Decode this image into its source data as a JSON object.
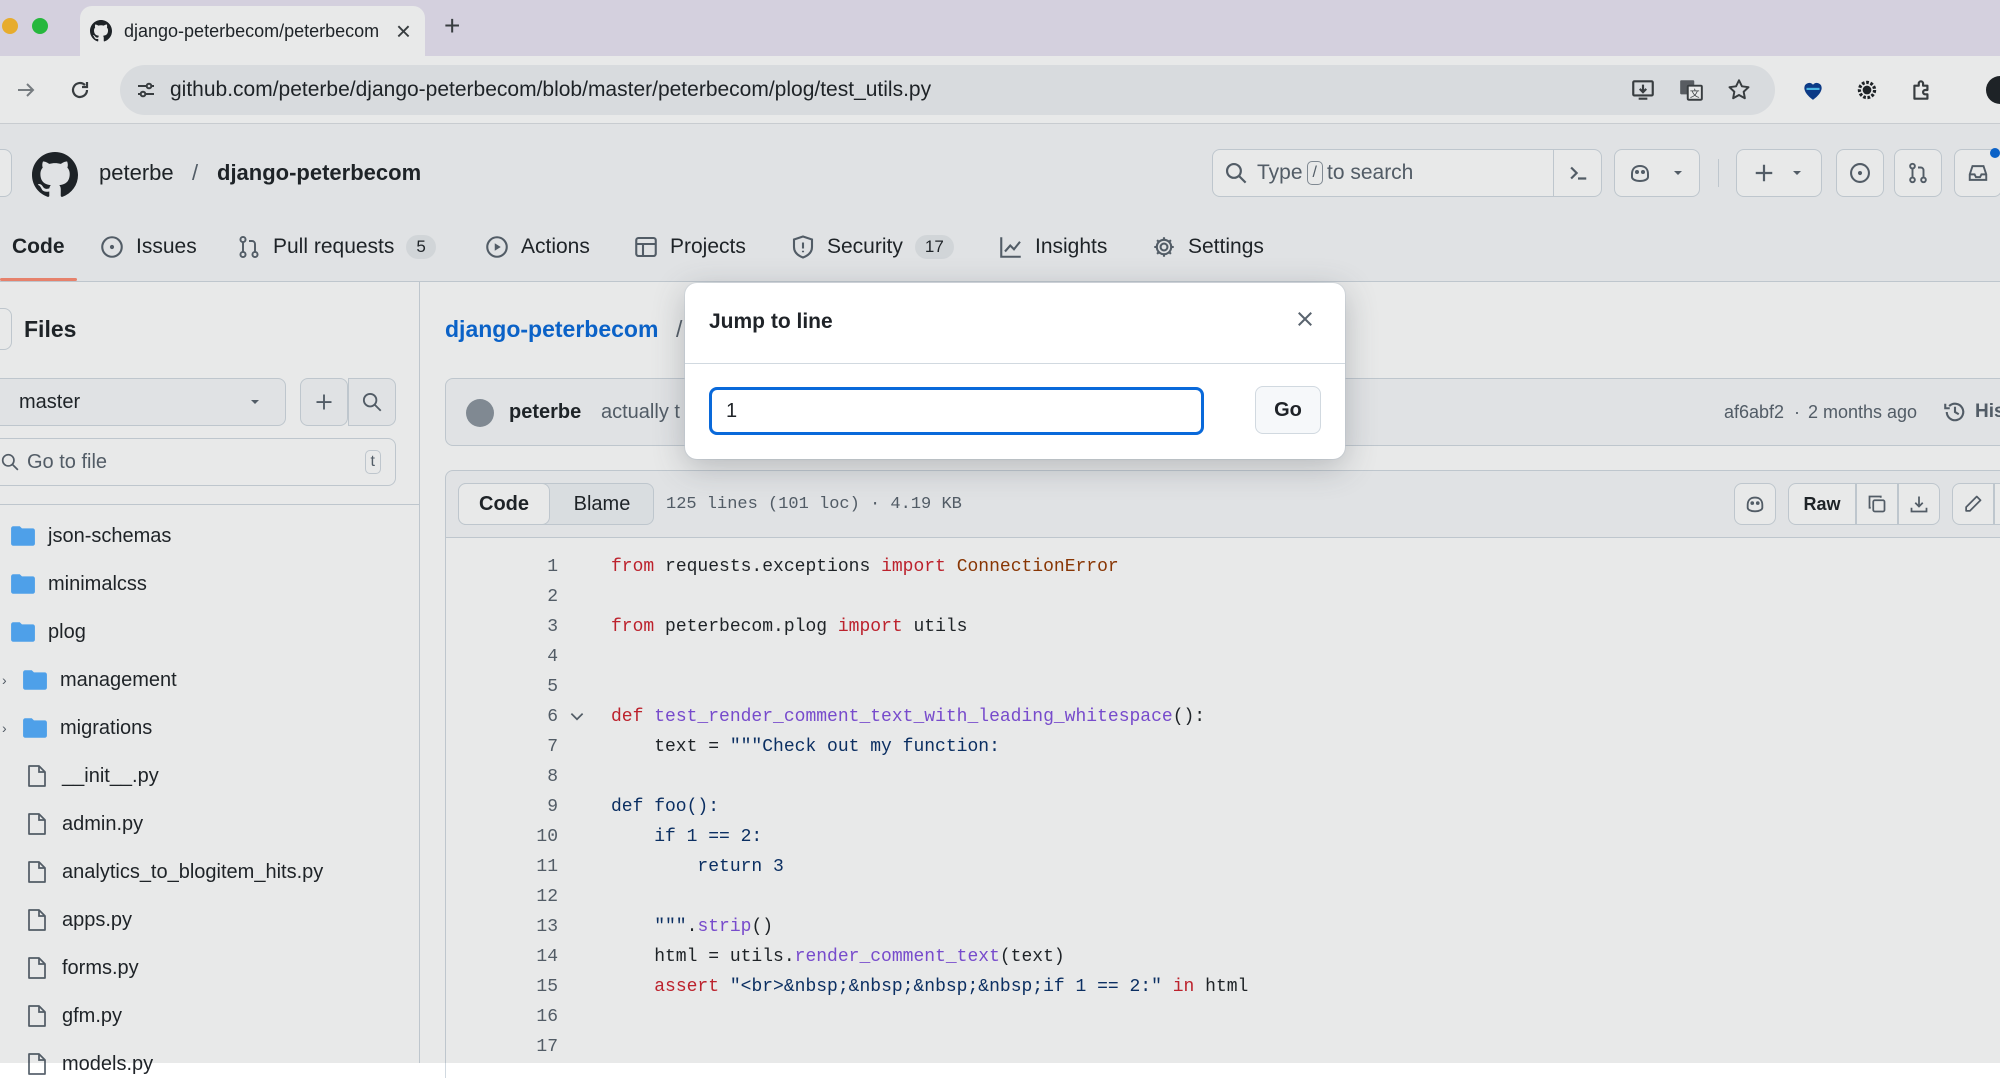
{
  "browser": {
    "tab_title": "django-peterbecom/peterbecom",
    "url": "github.com/peterbe/django-peterbecom/blob/master/peterbecom/plog/test_utils.py",
    "new_tab": "+",
    "close_tab": "×"
  },
  "header": {
    "owner": "peterbe",
    "separator": "/",
    "repo": "django-peterbecom",
    "search_prefix": "Type",
    "search_key": "/",
    "search_suffix": "to search"
  },
  "repo_nav": [
    {
      "label": "Code",
      "icon": "code-icon"
    },
    {
      "label": "Issues",
      "icon": "issue-opened-icon"
    },
    {
      "label": "Pull requests",
      "icon": "git-pull-request-icon",
      "count": "5"
    },
    {
      "label": "Actions",
      "icon": "play-icon"
    },
    {
      "label": "Projects",
      "icon": "table-icon"
    },
    {
      "label": "Security",
      "icon": "shield-icon",
      "count": "17"
    },
    {
      "label": "Insights",
      "icon": "graph-icon"
    },
    {
      "label": "Settings",
      "icon": "gear-icon"
    }
  ],
  "sidebar": {
    "title": "Files",
    "branch": "master",
    "go_to_file_placeholder": "Go to file",
    "go_to_file_key": "t",
    "tree": [
      {
        "name": "json-schemas",
        "type": "folder"
      },
      {
        "name": "minimalcss",
        "type": "folder"
      },
      {
        "name": "plog",
        "type": "folder-open"
      },
      {
        "name": "management",
        "type": "folder"
      },
      {
        "name": "migrations",
        "type": "folder"
      },
      {
        "name": "__init__.py",
        "type": "file"
      },
      {
        "name": "admin.py",
        "type": "file"
      },
      {
        "name": "analytics_to_blogitem_hits.py",
        "type": "file"
      },
      {
        "name": "apps.py",
        "type": "file"
      },
      {
        "name": "forms.py",
        "type": "file"
      },
      {
        "name": "gfm.py",
        "type": "file"
      },
      {
        "name": "models.py",
        "type": "file"
      }
    ]
  },
  "main": {
    "breadcrumb_repo": "django-peterbecom",
    "breadcrumb_sep": "/",
    "commit_author": "peterbe",
    "commit_message": "actually t",
    "commit_sha": "af6abf2",
    "commit_dot": "·",
    "commit_time": "2 months ago",
    "history_label": "His",
    "tab_code": "Code",
    "tab_blame": "Blame",
    "file_info": "125 lines (101 loc) · 4.19 KB",
    "raw_label": "Raw"
  },
  "code_lines": [
    {
      "n": "1",
      "tokens": [
        [
          "kw",
          "from"
        ],
        [
          "p",
          " requests.exceptions "
        ],
        [
          "kw",
          "import"
        ],
        [
          "p",
          " "
        ],
        [
          "cl",
          "ConnectionError"
        ]
      ]
    },
    {
      "n": "2",
      "tokens": []
    },
    {
      "n": "3",
      "tokens": [
        [
          "kw",
          "from"
        ],
        [
          "p",
          " peterbecom.plog "
        ],
        [
          "kw",
          "import"
        ],
        [
          "p",
          " utils"
        ]
      ]
    },
    {
      "n": "4",
      "tokens": []
    },
    {
      "n": "5",
      "tokens": []
    },
    {
      "n": "6",
      "tokens": [
        [
          "kw",
          "def"
        ],
        [
          "p",
          " "
        ],
        [
          "fn",
          "test_render_comment_text_with_leading_whitespace"
        ],
        [
          "p",
          "():"
        ]
      ]
    },
    {
      "n": "7",
      "tokens": [
        [
          "p",
          "    text = "
        ],
        [
          "st",
          "\"\"\"Check out my function:"
        ]
      ]
    },
    {
      "n": "8",
      "tokens": []
    },
    {
      "n": "9",
      "tokens": [
        [
          "st",
          "def foo():"
        ]
      ]
    },
    {
      "n": "10",
      "tokens": [
        [
          "st",
          "    if 1 == 2:"
        ]
      ]
    },
    {
      "n": "11",
      "tokens": [
        [
          "st",
          "        return 3"
        ]
      ]
    },
    {
      "n": "12",
      "tokens": []
    },
    {
      "n": "13",
      "tokens": [
        [
          "st",
          "    \"\"\""
        ],
        [
          "p",
          "."
        ],
        [
          "fn",
          "strip"
        ],
        [
          "p",
          "()"
        ]
      ]
    },
    {
      "n": "14",
      "tokens": [
        [
          "p",
          "    html = utils."
        ],
        [
          "fn",
          "render_comment_text"
        ],
        [
          "p",
          "(text)"
        ]
      ]
    },
    {
      "n": "15",
      "tokens": [
        [
          "p",
          "    "
        ],
        [
          "kw",
          "assert"
        ],
        [
          "p",
          " "
        ],
        [
          "st",
          "\"<br>&nbsp;&nbsp;&nbsp;&nbsp;if 1 == 2:\""
        ],
        [
          "p",
          " "
        ],
        [
          "kw",
          "in"
        ],
        [
          "p",
          " html"
        ]
      ]
    },
    {
      "n": "16",
      "tokens": []
    },
    {
      "n": "17",
      "tokens": []
    }
  ],
  "dialog": {
    "title": "Jump to line",
    "input_value": "1",
    "go_label": "Go"
  },
  "colors": {
    "accent": "#0969da",
    "nav_underline": "#fd8c73",
    "folder": "#54aeff",
    "tabstrip": "#e9e4f3"
  }
}
